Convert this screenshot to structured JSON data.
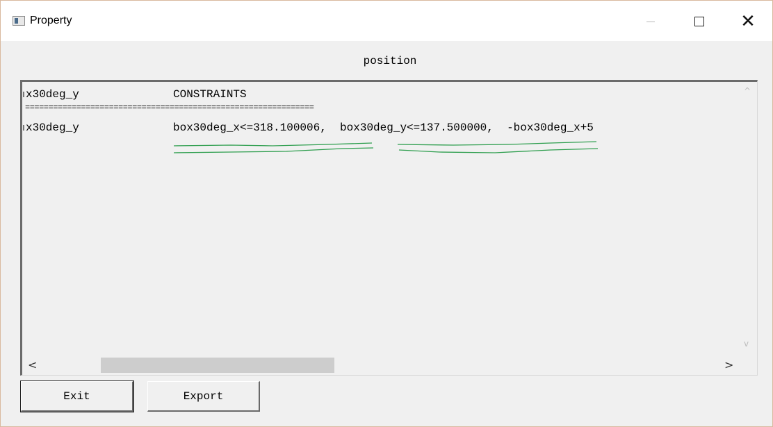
{
  "window": {
    "title": "Property",
    "icons": [
      "app-icon",
      "minimize-icon",
      "maximize-icon",
      "close-icon"
    ]
  },
  "heading": "position",
  "textbox": {
    "header_row": {
      "col1": "x30deg_y",
      "col2": "CONSTRAINTS"
    },
    "separator": "==============================================================",
    "data_row": {
      "col1": "x30deg_y",
      "col2": "box30deg_x<=318.100006,  box30deg_y<=137.500000,  -box30deg_x+5"
    },
    "annotation_color": "#2e9e4e"
  },
  "scrollbar": {
    "left_arrow": "<",
    "right_arrow": ">",
    "up_arrow": "^",
    "down_arrow": "v"
  },
  "buttons": {
    "exit_label": "Exit",
    "export_label": "Export"
  }
}
